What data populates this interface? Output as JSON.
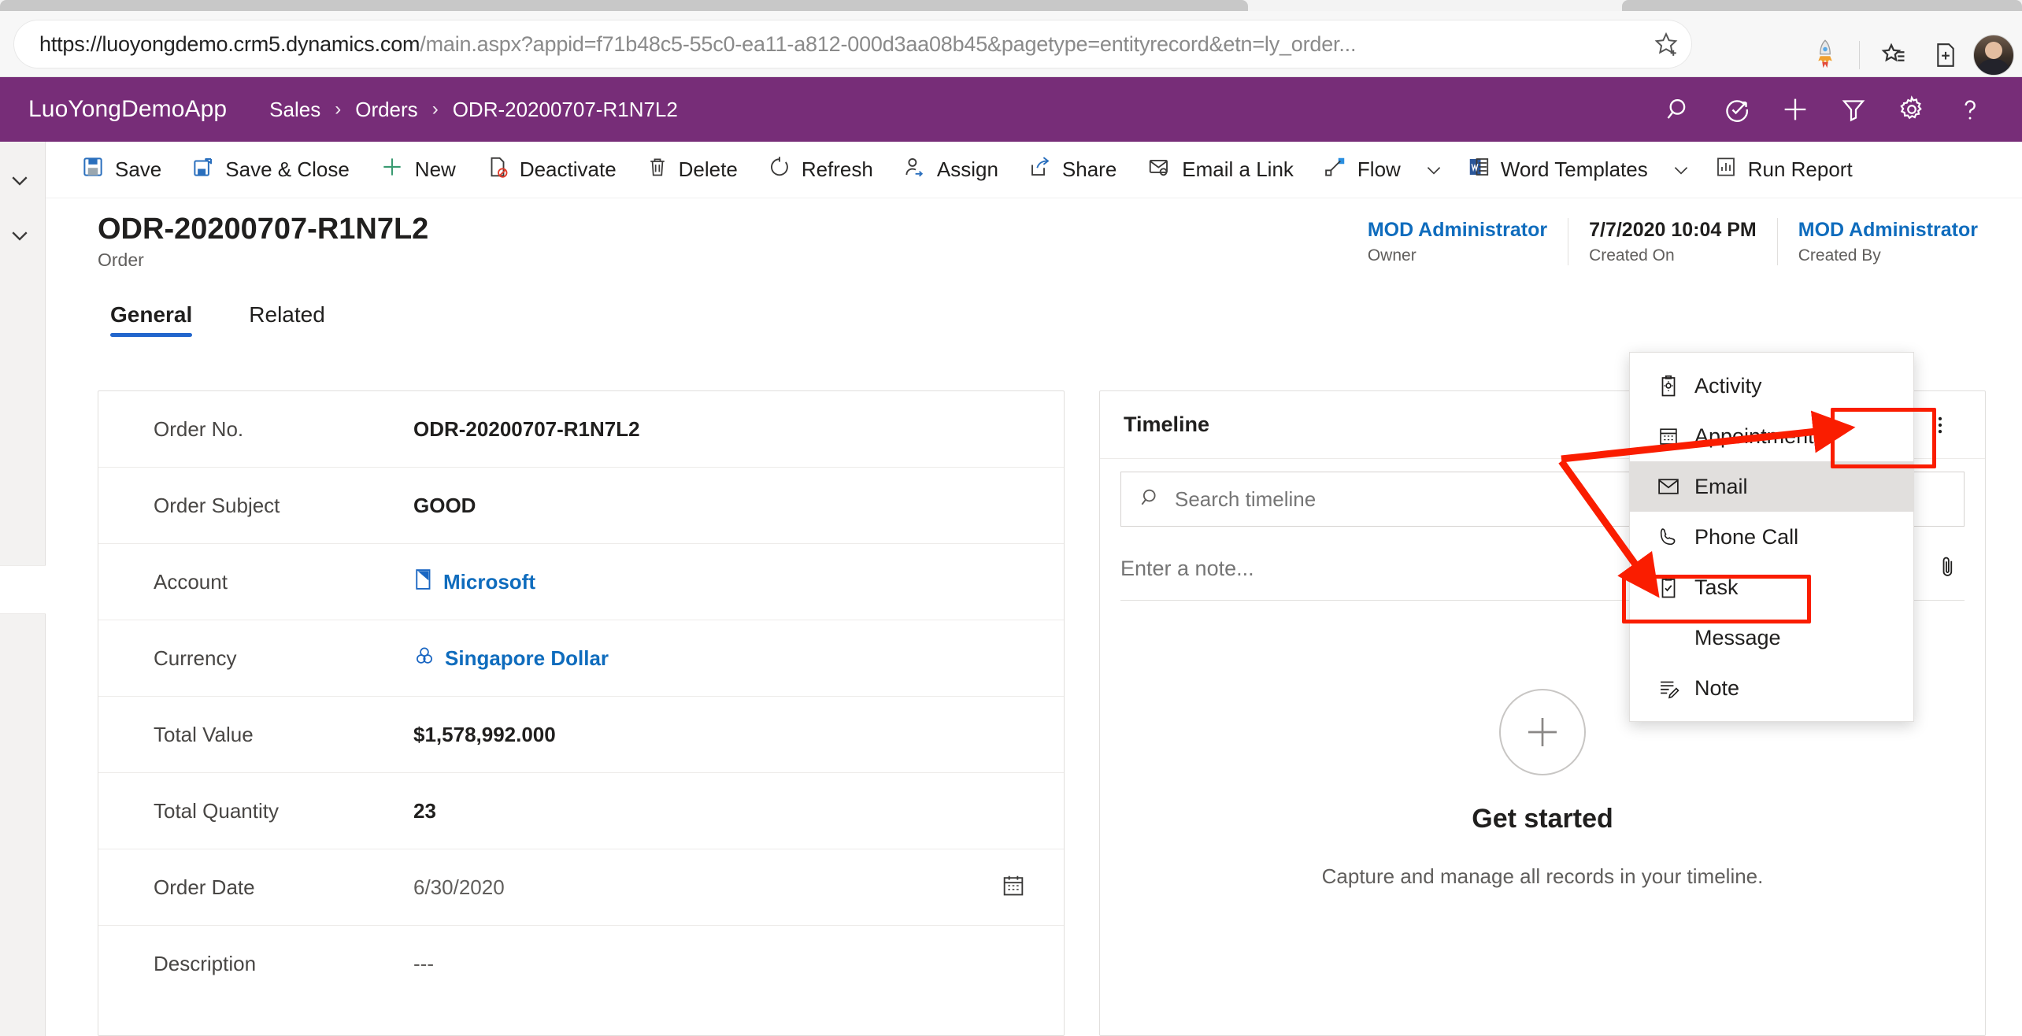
{
  "browser": {
    "url_host": "https://luoyongdemo.crm5.dynamics.com",
    "url_path": "/main.aspx?appid=f71b48c5-55c0-ea11-a812-000d3aa08b45&pagetype=entityrecord&etn=ly_order...",
    "icons": {
      "star": "star-add-icon",
      "extension": "rocket-extension-icon",
      "collections": "collections-icon",
      "favorites": "favorites-icon",
      "profile": "user-avatar-icon"
    }
  },
  "app_header": {
    "app_name": "LuoYongDemoApp",
    "breadcrumb": [
      {
        "label": "Sales"
      },
      {
        "label": "Orders"
      },
      {
        "label": "ODR-20200707-R1N7L2"
      }
    ],
    "separator": "›",
    "icons": [
      {
        "name": "search-icon",
        "title": "Search"
      },
      {
        "name": "assistant-icon",
        "title": "Relationship assistant"
      },
      {
        "name": "quick-create-icon",
        "title": "New"
      },
      {
        "name": "filter-icon",
        "title": "Filter"
      },
      {
        "name": "settings-gear-icon",
        "title": "Settings"
      },
      {
        "name": "help-icon",
        "title": "Help"
      }
    ],
    "background_color": "#772D78"
  },
  "command_bar": {
    "items": [
      {
        "label": "Save",
        "icon": "save-icon",
        "caret": false
      },
      {
        "label": "Save & Close",
        "icon": "save-close-icon",
        "caret": false
      },
      {
        "label": "New",
        "icon": "plus-icon",
        "caret": false
      },
      {
        "label": "Deactivate",
        "icon": "deactivate-icon",
        "caret": false
      },
      {
        "label": "Delete",
        "icon": "trash-icon",
        "caret": false
      },
      {
        "label": "Refresh",
        "icon": "refresh-icon",
        "caret": false
      },
      {
        "label": "Assign",
        "icon": "assign-person-icon",
        "caret": false
      },
      {
        "label": "Share",
        "icon": "share-icon",
        "caret": false
      },
      {
        "label": "Email a Link",
        "icon": "email-link-icon",
        "caret": false
      },
      {
        "label": "Flow",
        "icon": "flow-icon",
        "caret": true
      },
      {
        "label": "Word Templates",
        "icon": "word-icon",
        "caret": true
      },
      {
        "label": "Run Report",
        "icon": "report-icon",
        "caret": false
      }
    ]
  },
  "record_header": {
    "title": "ODR-20200707-R1N7L2",
    "subtitle": "Order",
    "meta": [
      {
        "value": "MOD Administrator",
        "label": "Owner",
        "link": true
      },
      {
        "value": "7/7/2020 10:04 PM",
        "label": "Created On",
        "link": false
      },
      {
        "value": "MOD Administrator",
        "label": "Created By",
        "link": true
      }
    ]
  },
  "form_tabs": [
    {
      "label": "General",
      "active": true
    },
    {
      "label": "Related",
      "active": false
    }
  ],
  "form": {
    "rows": [
      {
        "label": "Order No.",
        "value": "ODR-20200707-R1N7L2",
        "style": "strong",
        "icon": null,
        "trailing": null
      },
      {
        "label": "Order Subject",
        "value": "GOOD",
        "style": "strong",
        "icon": null,
        "trailing": null
      },
      {
        "label": "Account",
        "value": "Microsoft",
        "style": "link",
        "icon": "account-lookup-icon",
        "trailing": null
      },
      {
        "label": "Currency",
        "value": "Singapore Dollar",
        "style": "link",
        "icon": "currency-lookup-icon",
        "trailing": null
      },
      {
        "label": "Total Value",
        "value": "$1,578,992.000",
        "style": "strong",
        "icon": null,
        "trailing": null
      },
      {
        "label": "Total Quantity",
        "value": "23",
        "style": "strong",
        "icon": null,
        "trailing": null
      },
      {
        "label": "Order Date",
        "value": "6/30/2020",
        "style": "muted",
        "icon": null,
        "trailing": "calendar-icon"
      },
      {
        "label": "Description",
        "value": "---",
        "style": "muted",
        "icon": null,
        "trailing": null
      }
    ]
  },
  "timeline": {
    "title": "Timeline",
    "actions": [
      {
        "name": "create-timeline-record-button",
        "icon": "plus-icon",
        "highlighted": true
      },
      {
        "name": "timeline-filter-button",
        "icon": "filter-icon",
        "highlighted": false
      },
      {
        "name": "timeline-more-commands-button",
        "icon": "more-vertical-icon",
        "highlighted": false
      }
    ],
    "search_placeholder": "Search timeline",
    "search_value": "",
    "note_placeholder": "Enter a note...",
    "note_value": "",
    "attach_icon": "paperclip-icon",
    "empty_state": {
      "title": "Get started",
      "description": "Capture and manage all records in your timeline."
    },
    "menu": {
      "items": [
        {
          "label": "Activity",
          "icon": "activity-icon",
          "selected": false
        },
        {
          "label": "Appointment",
          "icon": "appointment-calendar-icon",
          "selected": false
        },
        {
          "label": "Email",
          "icon": "email-envelope-icon",
          "selected": true
        },
        {
          "label": "Phone Call",
          "icon": "phone-icon",
          "selected": false
        },
        {
          "label": "Task",
          "icon": "task-clipboard-icon",
          "selected": false
        },
        {
          "label": "Message",
          "icon": null,
          "selected": false
        },
        {
          "label": "Note",
          "icon": "note-icon",
          "selected": false
        }
      ]
    }
  },
  "annotations": {
    "color": "#fa1d00",
    "highlight_targets": [
      "create-timeline-record-button",
      "menu-item-email"
    ]
  }
}
